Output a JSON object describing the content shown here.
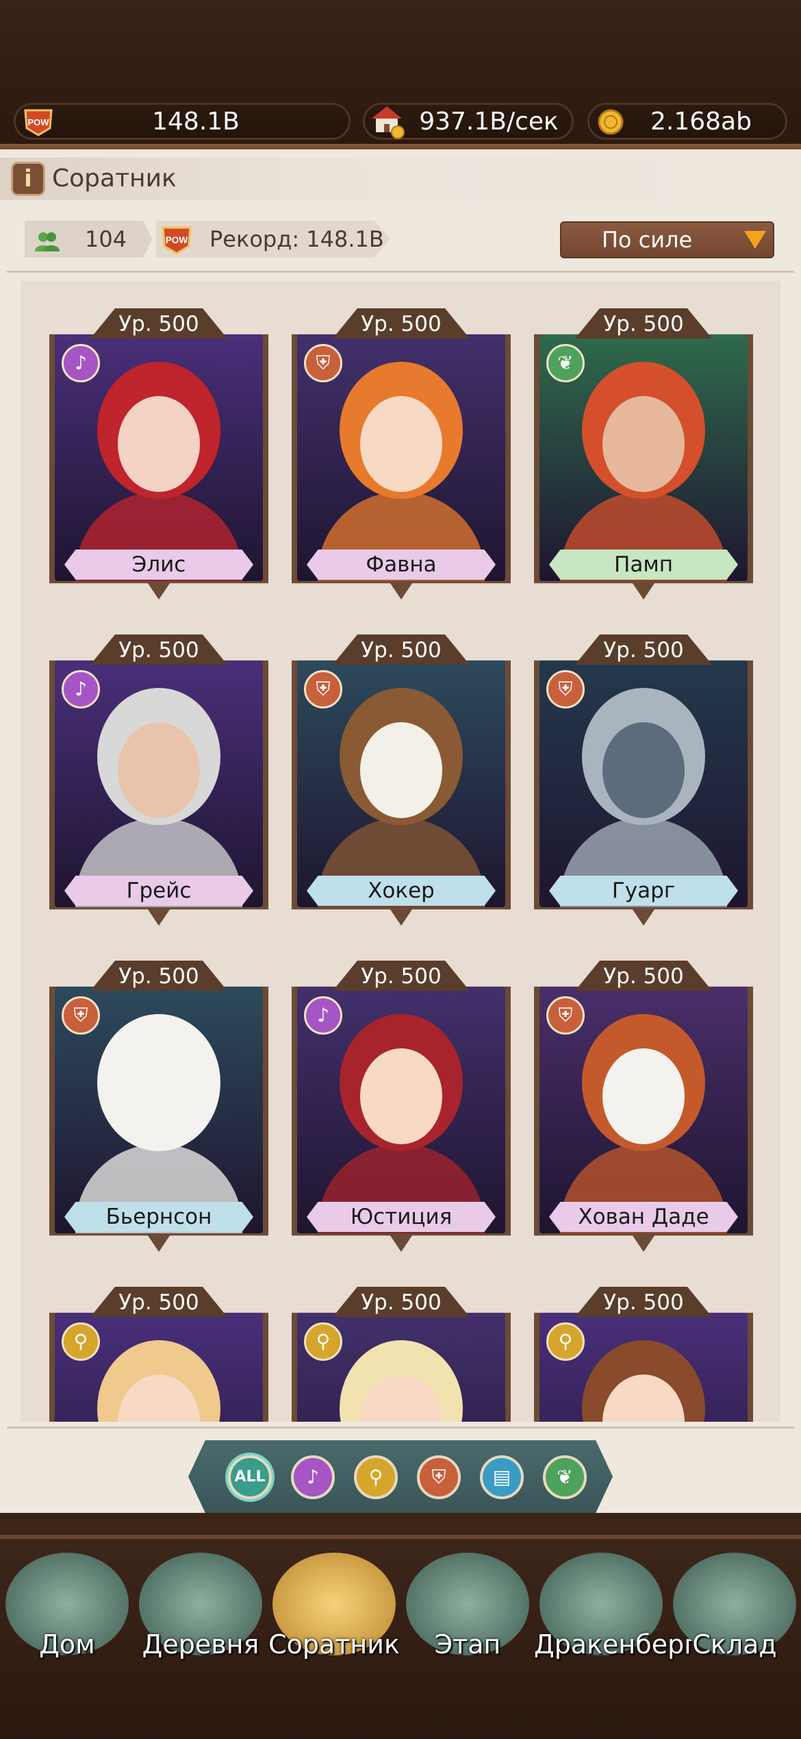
{
  "topbar": {
    "power": {
      "icon": "pow-icon",
      "badge": "POW",
      "value": "148.1B"
    },
    "income": {
      "icon": "house-income-icon",
      "value": "937.1B/сек"
    },
    "coins": {
      "icon": "coin-icon",
      "value": "2.168ab"
    }
  },
  "header": {
    "title": "Соратник",
    "info_icon": "i"
  },
  "stats": {
    "count": {
      "icon": "people-icon",
      "value": "104"
    },
    "record": {
      "icon": "pow-icon",
      "badge": "POW",
      "label": "Рекорд: 148.1B"
    }
  },
  "sort": {
    "label": "По силе",
    "arrow_icon": "triangle-down-icon"
  },
  "cards": [
    {
      "level": "Ур. 500",
      "name": "Элис",
      "class_icon": "lyre-icon",
      "class_color": "#a655c4",
      "bg": "#4a2f7a",
      "plate": "#e9cbe9",
      "hair": "#c0242c",
      "skin": "#f4d2c4"
    },
    {
      "level": "Ур. 500",
      "name": "Фавна",
      "class_icon": "shield-icon",
      "class_color": "#c8603c",
      "bg": "#43306c",
      "plate": "#e9cbe9",
      "hair": "#e77a2c",
      "skin": "#f7d9c4"
    },
    {
      "level": "Ур. 500",
      "name": "Памп",
      "class_icon": "wing-icon",
      "class_color": "#4ea35c",
      "bg": "#2f6a4c",
      "plate": "#c7e6c2",
      "hair": "#d4502c",
      "skin": "#e7b79c"
    },
    {
      "level": "Ур. 500",
      "name": "Грейс",
      "class_icon": "lyre-icon",
      "class_color": "#a655c4",
      "bg": "#4a2f7a",
      "plate": "#e9cbe9",
      "hair": "#d8d8d8",
      "skin": "#e9c4ac"
    },
    {
      "level": "Ур. 500",
      "name": "Хокер",
      "class_icon": "shield-icon",
      "class_color": "#c8603c",
      "bg": "#2d4a5c",
      "plate": "#bfe0ea",
      "hair": "#8a5a34",
      "skin": "#f2f0e8"
    },
    {
      "level": "Ур. 500",
      "name": "Гуарг",
      "class_icon": "shield-icon",
      "class_color": "#c8603c",
      "bg": "#24394c",
      "plate": "#bfe0ea",
      "hair": "#aab4bf",
      "skin": "#5c6c7c"
    },
    {
      "level": "Ур. 500",
      "name": "Бьернсон",
      "class_icon": "shield-icon",
      "class_color": "#c8603c",
      "bg": "#2d4a5c",
      "plate": "#bfe0ea",
      "hair": "#f4f2ee",
      "skin": "#f4f2ee"
    },
    {
      "level": "Ур. 500",
      "name": "Юстиция",
      "class_icon": "lyre-icon",
      "class_color": "#a655c4",
      "bg": "#43306c",
      "plate": "#e9cbe9",
      "hair": "#a8242c",
      "skin": "#f7d9c4"
    },
    {
      "level": "Ур. 500",
      "name": "Хован Даде",
      "class_icon": "shield-icon",
      "class_color": "#c8603c",
      "bg": "#4a2f6a",
      "plate": "#e9cbe9",
      "hair": "#c45a2c",
      "skin": "#f4f2ee"
    },
    {
      "level": "Ур. 500",
      "name": "",
      "class_icon": "broom-icon",
      "class_color": "#d6a52c",
      "bg": "#4a2f7a",
      "plate": "#e9cbe9",
      "hair": "#f0c98c",
      "skin": "#f7d9c4"
    },
    {
      "level": "Ур. 500",
      "name": "",
      "class_icon": "broom-icon",
      "class_color": "#d6a52c",
      "bg": "#43306c",
      "plate": "#e9cbe9",
      "hair": "#f2e2b0",
      "skin": "#f7d9c4"
    },
    {
      "level": "Ур. 500",
      "name": "",
      "class_icon": "broom-icon",
      "class_color": "#d6a52c",
      "bg": "#4a2f7a",
      "plate": "#e9cbe9",
      "hair": "#8a4a2c",
      "skin": "#f7d9c4"
    }
  ],
  "filters": [
    {
      "label": "ALL",
      "icon": "all-icon",
      "color": "#3a9c8c"
    },
    {
      "label": "",
      "icon": "lyre-icon",
      "color": "#a655c4"
    },
    {
      "label": "",
      "icon": "broom-icon",
      "color": "#d6a52c"
    },
    {
      "label": "",
      "icon": "shield-icon",
      "color": "#c8603c"
    },
    {
      "label": "",
      "icon": "book-icon",
      "color": "#3a9cc4"
    },
    {
      "label": "",
      "icon": "wing-icon",
      "color": "#4ea35c"
    }
  ],
  "nav": [
    {
      "label": "Дом",
      "icon": "bed-icon"
    },
    {
      "label": "Деревня",
      "icon": "windmill-icon"
    },
    {
      "label": "Соратник",
      "icon": "companions-icon",
      "active": true
    },
    {
      "label": "Этап",
      "icon": "tent-icon"
    },
    {
      "label": "Дракенберг",
      "icon": "castle-icon"
    },
    {
      "label": "Склад",
      "icon": "warehouse-icon"
    }
  ]
}
